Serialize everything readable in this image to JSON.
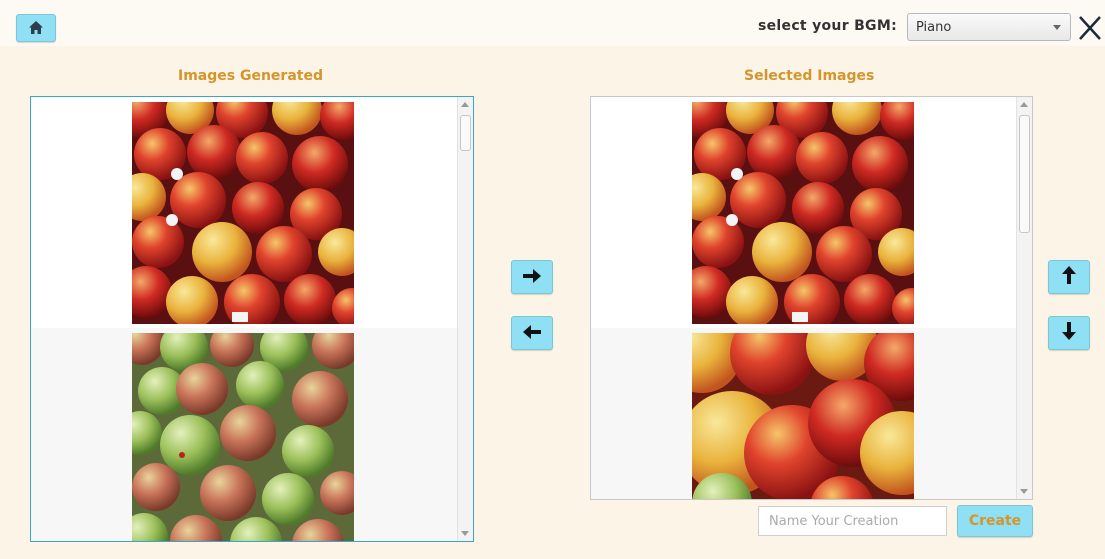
{
  "topbar": {
    "home_icon": "home-icon",
    "bgm_label": "select your BGM:",
    "bgm_selected": "Piano",
    "close_icon": "close-icon"
  },
  "left_panel": {
    "title": "Images Generated",
    "images": [
      {
        "name": "image-red-apples"
      },
      {
        "name": "image-green-apples"
      }
    ]
  },
  "right_panel": {
    "title": "Selected Images",
    "images": [
      {
        "name": "image-red-apples"
      },
      {
        "name": "image-red-yellow-apples-closeup"
      }
    ]
  },
  "transfer": {
    "add_icon": "arrow-right-icon",
    "remove_icon": "arrow-left-icon"
  },
  "reorder": {
    "up_icon": "arrow-up-icon",
    "down_icon": "arrow-down-icon"
  },
  "footer": {
    "name_placeholder": "Name Your Creation",
    "create_label": "Create"
  },
  "colors": {
    "background": "#fcf4e6",
    "accent_button": "#8fe0f5",
    "heading": "#d4952a",
    "selected_border": "#3ba3d0"
  }
}
